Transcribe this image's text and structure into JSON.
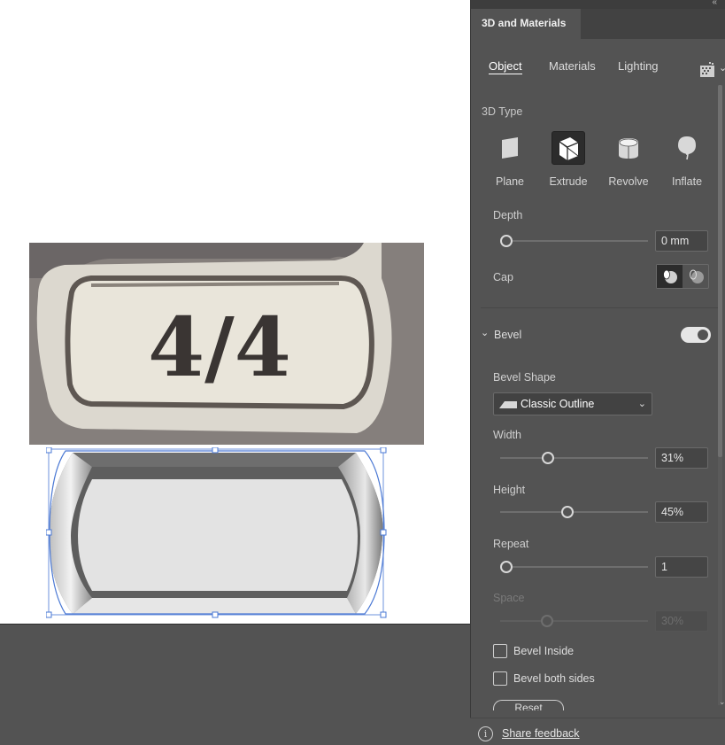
{
  "panel": {
    "collapse_glyph": "«",
    "title": "3D and Materials",
    "tabs": [
      "Object",
      "Materials",
      "Lighting"
    ],
    "active_tab": "Object"
  },
  "object": {
    "type_label": "3D Type",
    "types": [
      {
        "label": "Plane",
        "icon": "plane-icon"
      },
      {
        "label": "Extrude",
        "icon": "extrude-icon",
        "active": true
      },
      {
        "label": "Revolve",
        "icon": "revolve-icon"
      },
      {
        "label": "Inflate",
        "icon": "inflate-icon"
      }
    ],
    "depth_label": "Depth",
    "depth_value": "0 mm",
    "depth_fraction": 0,
    "cap_label": "Cap"
  },
  "bevel": {
    "title": "Bevel",
    "enabled": true,
    "shape_label": "Bevel Shape",
    "shape_value": "Classic Outline",
    "width_label": "Width",
    "width_value": "31%",
    "width_fraction": 0.31,
    "height_label": "Height",
    "height_value": "45%",
    "height_fraction": 0.45,
    "repeat_label": "Repeat",
    "repeat_value": "1",
    "repeat_fraction": 0,
    "space_label": "Space",
    "space_value": "30%",
    "space_fraction": 0.3,
    "inside_label": "Bevel Inside",
    "both_sides_label": "Bevel both sides",
    "reset_label": "Reset"
  },
  "canvas": {
    "photo_text": "4/4"
  },
  "footer": {
    "feedback_label": "Share feedback"
  }
}
